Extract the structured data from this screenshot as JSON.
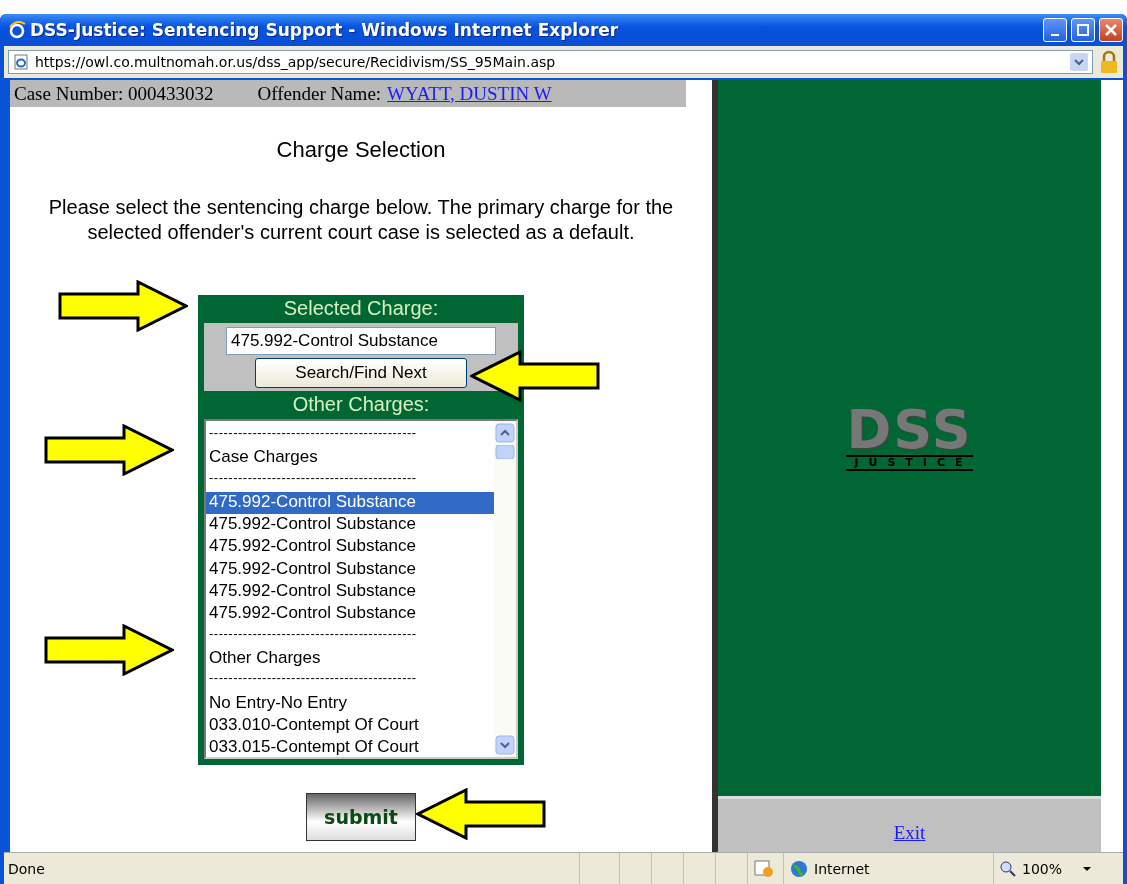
{
  "window": {
    "title": "DSS-Justice: Sentencing Support - Windows Internet Explorer"
  },
  "address_bar": {
    "url": "https://owl.co.multnomah.or.us/dss_app/secure/Recidivism/SS_95Main.asp"
  },
  "case_bar": {
    "case_label": "Case Number: 000433032",
    "offender_label": "Offender Name:",
    "offender_name": "WYATT, DUSTIN W"
  },
  "heading": "Charge Selection",
  "instructions": "Please select the sentencing charge below. The primary charge for the selected offender's current court case is selected as a default.",
  "selected_charge": {
    "title": "Selected Charge:",
    "value": "475.992-Control Substance",
    "search_button": "Search/Find Next"
  },
  "other_charges": {
    "title": "Other Charges:",
    "items": [
      {
        "kind": "separator",
        "text": "-------------------------------------------",
        "selected": false
      },
      {
        "kind": "heading",
        "text": "Case Charges",
        "selected": false
      },
      {
        "kind": "separator",
        "text": "-------------------------------------------",
        "selected": false
      },
      {
        "kind": "charge",
        "text": "475.992-Control Substance",
        "selected": true
      },
      {
        "kind": "charge",
        "text": "475.992-Control Substance",
        "selected": false
      },
      {
        "kind": "charge",
        "text": "475.992-Control Substance",
        "selected": false
      },
      {
        "kind": "charge",
        "text": "475.992-Control Substance",
        "selected": false
      },
      {
        "kind": "charge",
        "text": "475.992-Control Substance",
        "selected": false
      },
      {
        "kind": "charge",
        "text": "475.992-Control Substance",
        "selected": false
      },
      {
        "kind": "separator",
        "text": "-------------------------------------------",
        "selected": false
      },
      {
        "kind": "heading",
        "text": "Other Charges",
        "selected": false
      },
      {
        "kind": "separator",
        "text": "-------------------------------------------",
        "selected": false
      },
      {
        "kind": "charge",
        "text": "No Entry-No Entry",
        "selected": false
      },
      {
        "kind": "charge",
        "text": "033.010-Contempt Of Court",
        "selected": false
      },
      {
        "kind": "charge",
        "text": "033.015-Contempt Of Court",
        "selected": false
      }
    ]
  },
  "submit_button": "submit",
  "logo": {
    "title": "DSS",
    "subtitle": "JUSTICE"
  },
  "exit_link": "Exit",
  "status_bar": {
    "status": "Done",
    "zone": "Internet",
    "zoom": "100%"
  }
}
